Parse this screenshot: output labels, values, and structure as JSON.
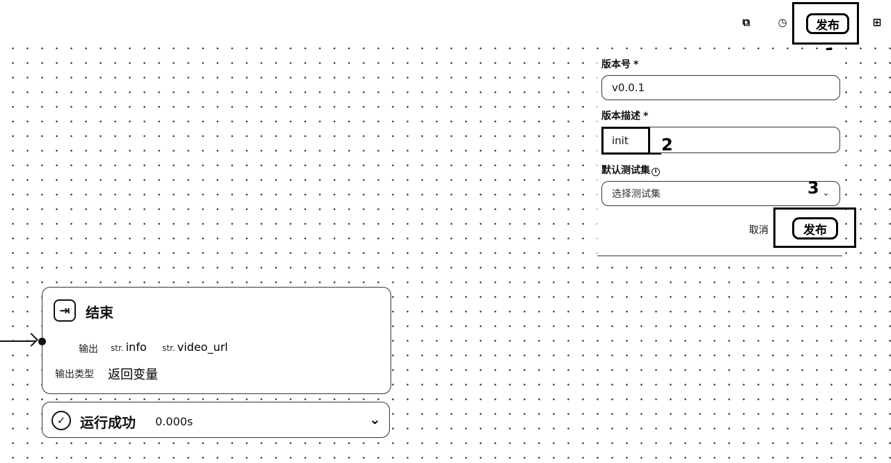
{
  "toolbar": {
    "icons": [
      "copy-icon",
      "history-icon",
      "add-icon"
    ],
    "publish_label": "发布"
  },
  "annotations": {
    "a1": "1",
    "a2": "2",
    "a3": "3"
  },
  "publish_panel": {
    "version_label": "版本号",
    "required_mark": "*",
    "version_value": "v0.0.1",
    "desc_label": "版本描述",
    "desc_value": "init",
    "testset_label": "默认测试集",
    "testset_placeholder": "选择测试集",
    "cancel_label": "取消",
    "submit_label": "发布"
  },
  "end_node": {
    "title": "结束",
    "output_label": "输出",
    "outputs": [
      {
        "type": "str.",
        "name": "info"
      },
      {
        "type": "str.",
        "name": "video_url"
      }
    ],
    "output_type_label": "输出类型",
    "output_type_value": "返回变量"
  },
  "run_status": {
    "text": "运行成功",
    "time": "0.000s"
  }
}
